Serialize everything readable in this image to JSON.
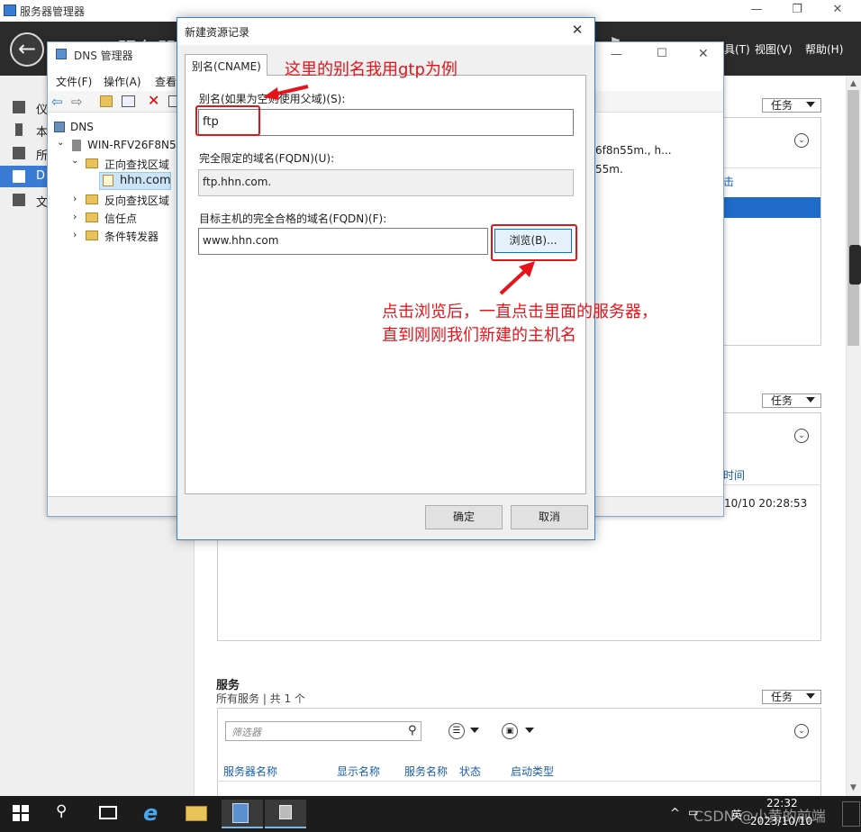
{
  "server_manager": {
    "title": "服务器管理器",
    "heading": "服务器管",
    "menu": {
      "tools": "具(T)",
      "view": "视图(V)",
      "help": "帮助(H)"
    },
    "nav": [
      {
        "label": "仪"
      },
      {
        "label": "本"
      },
      {
        "label": "所"
      },
      {
        "label": "D"
      },
      {
        "label": "文"
      }
    ],
    "tasks_label": "任务",
    "panel1_lines": [
      "6f8n55m., h...",
      "55m."
    ],
    "panel1_side_link": "击",
    "panel2_col_time": "时间",
    "panel2_timestamp": "10/10 20:28:53",
    "services": {
      "title": "服务",
      "subtitle": "所有服务 | 共 1 个",
      "filter_placeholder": "筛选器",
      "columns": [
        "服务器名称",
        "显示名称",
        "服务名称",
        "状态",
        "启动类型"
      ]
    }
  },
  "dns_manager": {
    "title": "DNS 管理器",
    "menu": [
      "文件(F)",
      "操作(A)",
      "查看"
    ],
    "tree": {
      "root": "DNS",
      "server": "WIN-RFV26F8N55",
      "forward_zone": "正向查找区域",
      "zone": "hhn.com",
      "reverse_zone": "反向查找区域",
      "trust_points": "信任点",
      "conditional_forwarders": "条件转发器"
    }
  },
  "dialog": {
    "title": "新建资源记录",
    "tab": "别名(CNAME)",
    "alias_label": "别名(如果为空则使用父域)(S):",
    "alias_value": "ftp",
    "fqdn_label": "完全限定的域名(FQDN)(U):",
    "fqdn_value": "ftp.hhn.com.",
    "target_label": "目标主机的完全合格的域名(FQDN)(F):",
    "target_value": "www.hhn.com",
    "browse_button": "浏览(B)...",
    "ok_button": "确定",
    "cancel_button": "取消"
  },
  "annotations": {
    "alias_note": "这里的别名我用gtp为例",
    "browse_note_line1": "点击浏览后，一直点击里面的服务器，",
    "browse_note_line2": "直到刚刚我们新建的主机名",
    "accent_color": "#e5141b"
  },
  "taskbar": {
    "time": "22:32",
    "date": "2023/10/10",
    "ime": "英",
    "watermark": "CSDN @小黄的前端"
  }
}
